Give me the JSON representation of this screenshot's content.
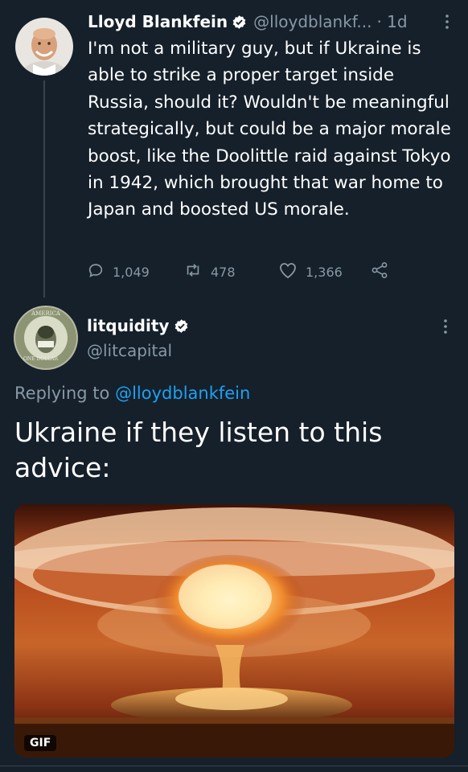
{
  "tweet": {
    "author_name": "Lloyd Blankfein",
    "author_handle": "@lloydblankf...",
    "time": "· 1d",
    "text": "I'm not a military guy, but if Ukraine is able to strike a proper target inside Russia, should it? Wouldn't be meaningful strategically, but could be a major morale boost, like the Doolittle raid against Tokyo in 1942, which brought that war home to Japan and boosted US morale.",
    "replies": "1,049",
    "retweets": "478",
    "likes": "1,366"
  },
  "reply": {
    "author_name": "litquidity",
    "author_handle": "@litcapital",
    "replying_prefix": "Replying to",
    "replying_to": "@lloydblankfein",
    "text": "Ukraine if they listen to this advice:",
    "media_badge": "GIF"
  },
  "colors": {
    "background": "#15202b",
    "secondary_text": "#8899a6",
    "link": "#1da1f2"
  },
  "icons": [
    "verified-badge-icon",
    "more-options-icon",
    "reply-icon",
    "retweet-icon",
    "like-icon",
    "share-icon"
  ]
}
